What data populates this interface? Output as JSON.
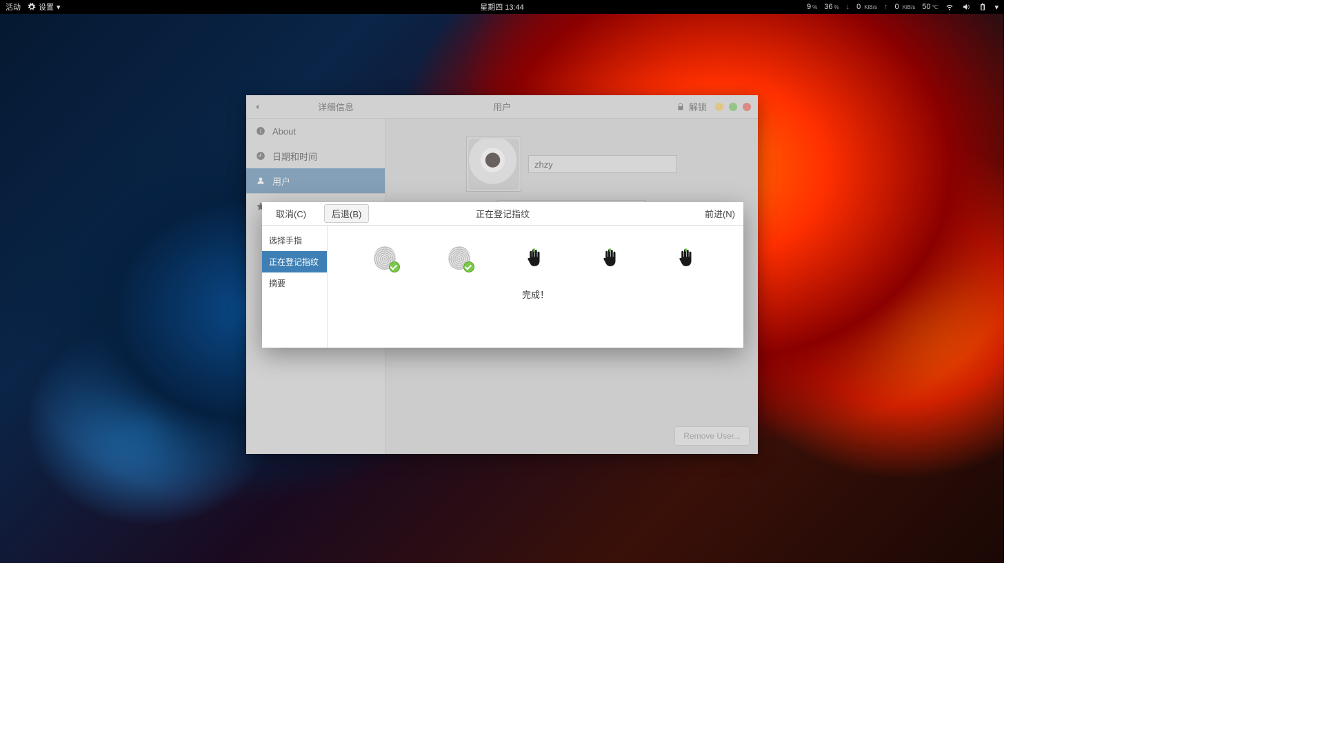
{
  "topbar": {
    "activities": "活动",
    "settings_menu": "设置",
    "datetime": "星期四 13:44",
    "cpu": "9",
    "mem": "36",
    "net_down": "0",
    "net_down_unit": "KiB/s",
    "net_up": "0",
    "net_up_unit": "KiB/s",
    "temp": "50",
    "temp_unit": "℃",
    "pct": "%"
  },
  "settings": {
    "header": {
      "details_title": "详细信息",
      "page_title": "用户",
      "unlock": "解锁"
    },
    "sidebar": {
      "items": [
        {
          "icon": "info",
          "label": "About"
        },
        {
          "icon": "clock",
          "label": "日期和时间"
        },
        {
          "icon": "users",
          "label": "用户"
        }
      ]
    },
    "main": {
      "username": "zhzy",
      "password_mask": "●●●●●",
      "remove_user": "Remove User..."
    }
  },
  "fp": {
    "buttons": {
      "cancel": "取消(C)",
      "back": "后退(B)",
      "next": "前进(N)"
    },
    "title": "正在登记指纹",
    "steps": {
      "select": "选择手指",
      "enroll": "正在登记指纹",
      "summary": "摘要"
    },
    "done": "完成！"
  }
}
